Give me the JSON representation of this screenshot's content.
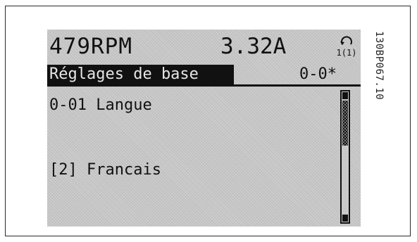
{
  "status": {
    "speed": "479RPM",
    "current": "3.32A",
    "motor_icon": "motor-rotation-icon",
    "motor_icon_setup": "1(1)"
  },
  "header": {
    "group_title": "Réglages de base",
    "parameter_code": "0-0*"
  },
  "parameter": {
    "name": "0-01 Langue",
    "value": "[2] Francais"
  },
  "scrollbar": {
    "position_fraction": 0.4
  },
  "figure_code": "130BP067.10",
  "colors": {
    "lcd_background": "#c9c9c9",
    "lcd_text": "#111111",
    "highlight_background": "#111111",
    "highlight_text": "#e6e6e6"
  }
}
